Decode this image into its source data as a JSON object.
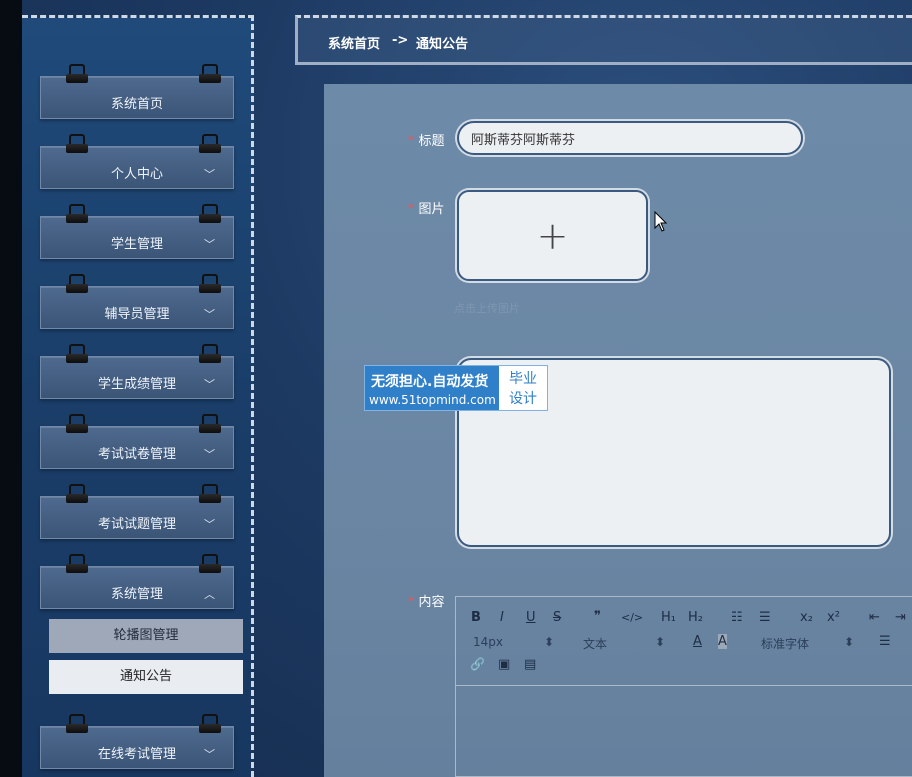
{
  "sidebar": {
    "items": [
      {
        "label": "系统首页",
        "chevron": ""
      },
      {
        "label": "个人中心",
        "chevron": "﹀"
      },
      {
        "label": "学生管理",
        "chevron": "﹀"
      },
      {
        "label": "辅导员管理",
        "chevron": "﹀"
      },
      {
        "label": "学生成绩管理",
        "chevron": "﹀"
      },
      {
        "label": "考试试卷管理",
        "chevron": "﹀"
      },
      {
        "label": "考试试题管理",
        "chevron": "﹀"
      },
      {
        "label": "系统管理",
        "chevron": "︿"
      },
      {
        "label": "在线考试管理",
        "chevron": "﹀"
      }
    ],
    "sub_items": [
      {
        "label": "轮播图管理"
      },
      {
        "label": "通知公告"
      }
    ]
  },
  "breadcrumb": {
    "home": "系统首页",
    "separator": "->",
    "current": "通知公告"
  },
  "form": {
    "title_label": "标题",
    "title_value": "阿斯蒂芬阿斯蒂芬",
    "image_label": "图片",
    "upload_plus": "+",
    "upload_hint": "点击上传图片",
    "content_label": "内容",
    "required_mark": "*"
  },
  "watermark": {
    "line1": "无须担心.自动发货",
    "line2": "www.51topmind.com",
    "side1": "毕业",
    "side2": "设计"
  },
  "editor": {
    "bold": "B",
    "italic": "I",
    "underline": "U",
    "strike": "S",
    "quote": "❞",
    "code": "</>",
    "h1": "H₁",
    "h2": "H₂",
    "ol": "☷",
    "ul": "☰",
    "sub": "x₂",
    "sup": "x²",
    "outdent": "⇤",
    "indent": "⇥",
    "font_size": "14px",
    "text_style": "文本",
    "font_family": "标准字体",
    "color": "A",
    "background": "A",
    "align": "☰",
    "link": "🔗",
    "image": "▣",
    "video": "▤",
    "dropdown": "⬍"
  },
  "colors": {
    "accent": "#2f7fc9",
    "required": "#ff4d4f"
  }
}
